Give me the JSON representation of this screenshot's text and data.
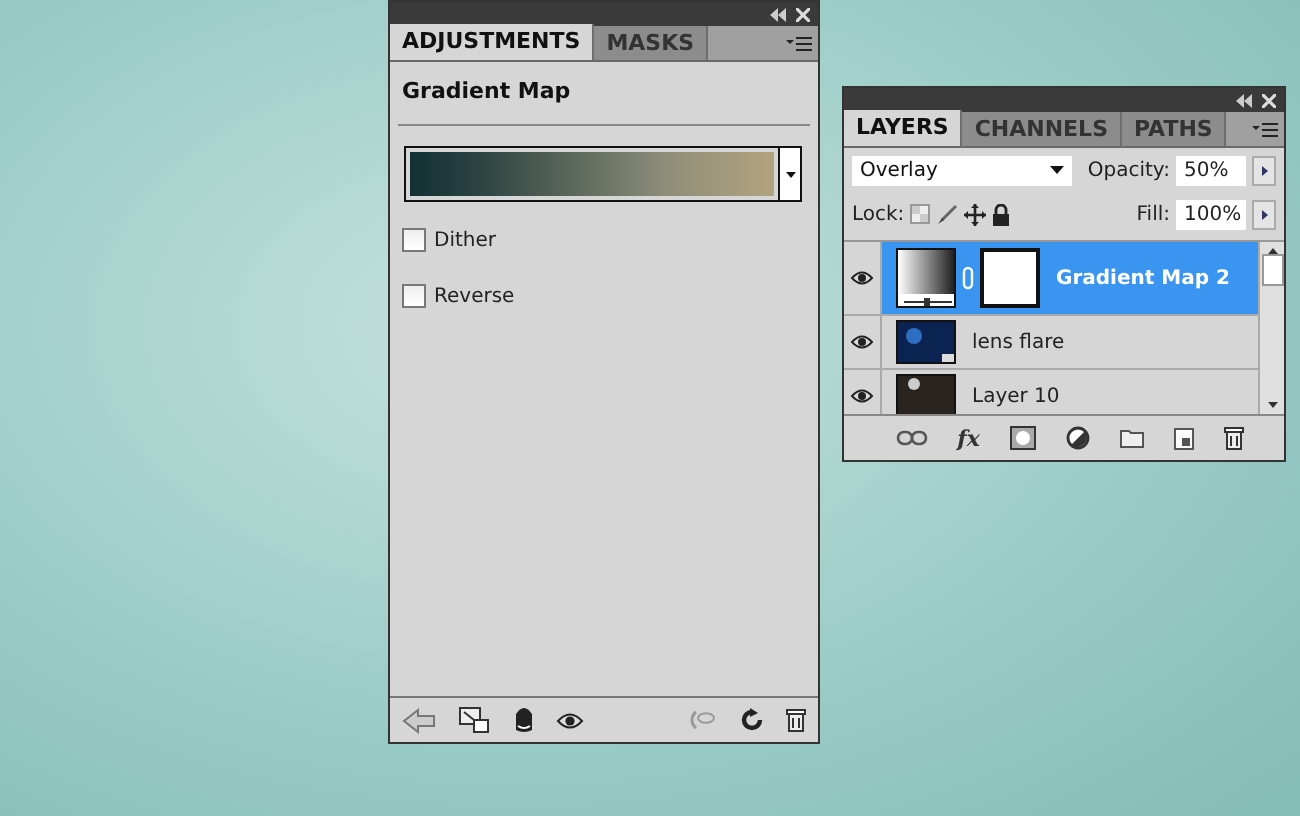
{
  "adjustments_panel": {
    "tabs": [
      {
        "label": "ADJUSTMENTS",
        "selected": true
      },
      {
        "label": "MASKS",
        "selected": false
      }
    ],
    "title": "Gradient Map",
    "options": [
      {
        "label": "Dither",
        "checked": false
      },
      {
        "label": "Reverse",
        "checked": false
      }
    ]
  },
  "layers_panel": {
    "tabs": [
      {
        "label": "LAYERS",
        "selected": true
      },
      {
        "label": "CHANNELS",
        "selected": false
      },
      {
        "label": "PATHS",
        "selected": false
      }
    ],
    "blend_mode": "Overlay",
    "opacity_label": "Opacity:",
    "opacity": "50%",
    "lock_label": "Lock:",
    "fill_label": "Fill:",
    "fill": "100%",
    "effects_button": "fx",
    "layers": [
      {
        "name": "Gradient Map 2",
        "kind": "adjustment",
        "selected": true,
        "visible": true
      },
      {
        "name": "lens flare",
        "kind": "pixel",
        "selected": false,
        "visible": true
      },
      {
        "name": "Layer 10",
        "kind": "dark",
        "selected": false,
        "visible": true
      }
    ]
  }
}
